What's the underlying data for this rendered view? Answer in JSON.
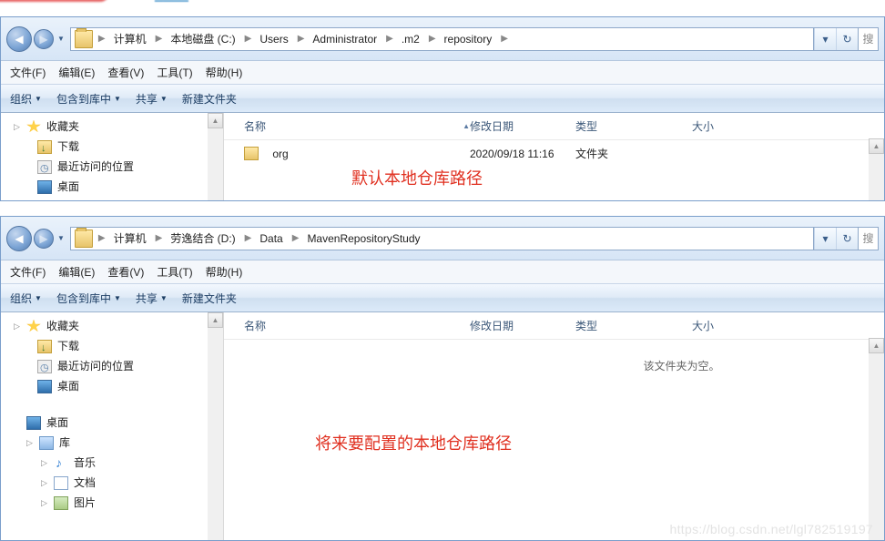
{
  "window1": {
    "breadcrumbs": [
      "计算机",
      "本地磁盘 (C:)",
      "Users",
      "Administrator",
      ".m2",
      "repository"
    ],
    "menus": {
      "file": "文件(F)",
      "edit": "编辑(E)",
      "view": "查看(V)",
      "tools": "工具(T)",
      "help": "帮助(H)"
    },
    "tools": {
      "organize": "组织",
      "include": "包含到库中",
      "share": "共享",
      "newfolder": "新建文件夹"
    },
    "tree": {
      "favorites": "收藏夹",
      "downloads": "下载",
      "recent": "最近访问的位置",
      "desktop": "桌面"
    },
    "columns": {
      "name": "名称",
      "date": "修改日期",
      "type": "类型",
      "size": "大小"
    },
    "rows": [
      {
        "name": "org",
        "date": "2020/09/18 11:16",
        "type": "文件夹"
      }
    ],
    "annotation": "默认本地仓库路径"
  },
  "window2": {
    "breadcrumbs": [
      "计算机",
      "劳逸结合 (D:)",
      "Data",
      "MavenRepositoryStudy"
    ],
    "menus": {
      "file": "文件(F)",
      "edit": "编辑(E)",
      "view": "查看(V)",
      "tools": "工具(T)",
      "help": "帮助(H)"
    },
    "tools": {
      "organize": "组织",
      "include": "包含到库中",
      "share": "共享",
      "newfolder": "新建文件夹"
    },
    "tree": {
      "favorites": "收藏夹",
      "downloads": "下载",
      "recent": "最近访问的位置",
      "desktop": "桌面",
      "desktop2": "桌面",
      "libraries": "库",
      "music": "音乐",
      "documents": "文档",
      "pictures": "图片"
    },
    "columns": {
      "name": "名称",
      "date": "修改日期",
      "type": "类型",
      "size": "大小"
    },
    "empty": "该文件夹为空。",
    "annotation": "将来要配置的本地仓库路径",
    "watermark": "https://blog.csdn.net/lgl782519197",
    "search_hint": "搜"
  }
}
